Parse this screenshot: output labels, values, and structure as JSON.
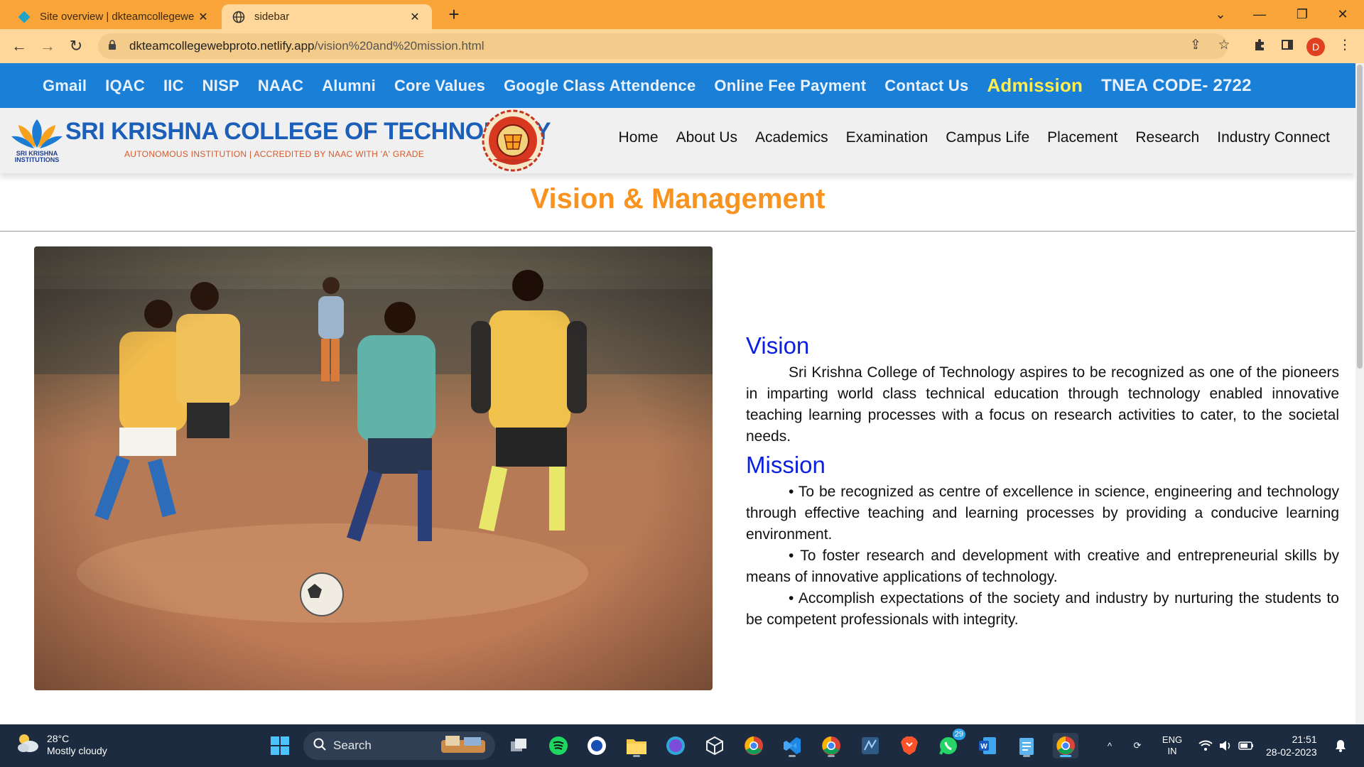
{
  "browser": {
    "tabs": [
      {
        "title": "Site overview | dkteamcollegewe",
        "active": false
      },
      {
        "title": "sidebar",
        "active": true
      }
    ],
    "url_host": "dkteamcollegewebproto.netlify.app",
    "url_path": "/vision%20and%20mission.html",
    "profile_initial": "D"
  },
  "site": {
    "top_links": [
      "Gmail",
      "IQAC",
      "IIC",
      "NISP",
      "NAAC",
      "Alumni",
      "Core Values",
      "Google Class Attendence",
      "Online Fee Payment",
      "Contact Us"
    ],
    "admission_label": "Admission",
    "tnea_label": "TNEA CODE- 2722",
    "brand_name": "SRI KRISHNA COLLEGE OF TECHNOLOGY",
    "brand_tagline": "AUTONOMOUS INSTITUTION | ACCREDITED BY NAAC WITH 'A' GRADE",
    "logo_caption": "SRI KRISHNA INSTITUTIONS",
    "main_nav": [
      "Home",
      "About Us",
      "Academics",
      "Examination",
      "Campus Life",
      "Placement",
      "Research",
      "Industry Connect"
    ],
    "page_title": "Vision & Management",
    "vision_heading": "Vision",
    "vision_text": "Sri Krishna College of Technology aspires to be recognized as one of the pioneers in imparting world class technical education through technology enabled innovative teaching learning processes with a focus on research activities to cater, to the societal needs.",
    "mission_heading": "Mission",
    "mission_points": [
      "• To be recognized as centre of excellence in science, engineering and technology through effective teaching and learning processes by providing a conducive learning environment.",
      "• To foster research and development with creative and entrepreneurial skills by means of innovative applications of technology.",
      "• Accomplish expectations of the society and industry by nurturing the students to be competent professionals with integrity."
    ]
  },
  "taskbar": {
    "weather_temp": "28°C",
    "weather_desc": "Mostly cloudy",
    "search_placeholder": "Search",
    "whatsapp_badge": "29",
    "language": "ENG",
    "region": "IN",
    "time": "21:51",
    "date": "28-02-2023"
  },
  "colors": {
    "tab_strip": "#f9a53a",
    "top_link_bar": "#1a7fd7",
    "admission": "#ffee4c",
    "page_title": "#f7931e",
    "headings": "#0b1fe0"
  }
}
